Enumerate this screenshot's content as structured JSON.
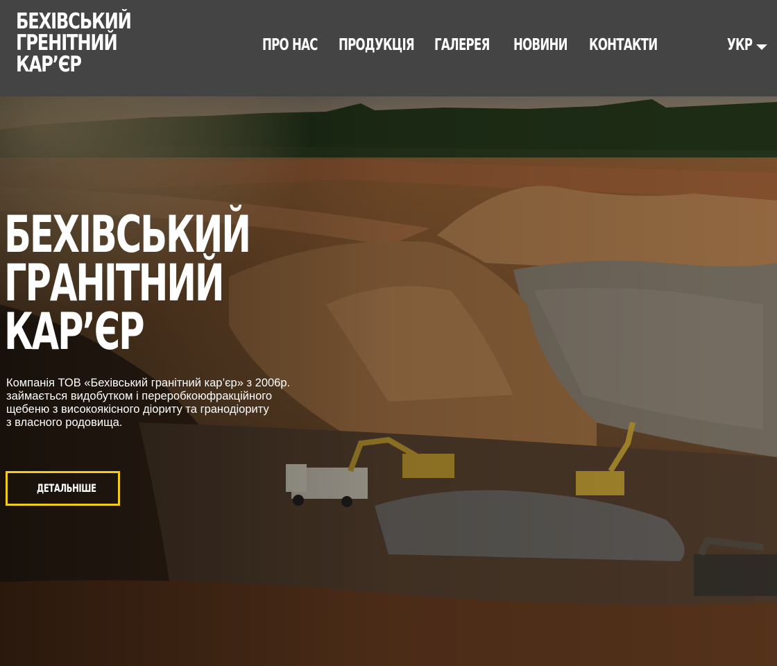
{
  "header": {
    "logo_lines": [
      "БЕХІВСЬКИЙ",
      "ГРЕНІТНИЙ",
      "КАР’ЄР"
    ],
    "nav": [
      {
        "label": "ПРО НАС"
      },
      {
        "label": "ПРОДУКЦІЯ"
      },
      {
        "label": "ГАЛЕРЕЯ"
      },
      {
        "label": "НОВИНИ"
      },
      {
        "label": "КОНТАКТИ"
      }
    ],
    "language": {
      "label": "УКР",
      "icon": "chevron-down-icon"
    }
  },
  "hero": {
    "background": "quarry-photo",
    "title_lines": [
      "БЕХІВСЬКИЙ",
      "ГРАНІТНИЙ",
      "КАР’ЄР"
    ],
    "description_lines": [
      "Компанія ТОВ «Бехівський гранітний кар’єр» з 2006р.",
      "займається видобутком і переробкоюфракційного",
      "щебеню з високоякісного діориту та гранодіориту",
      "з власного родовища."
    ],
    "button_label": "ДЕТАЛЬНІШЕ"
  },
  "colors": {
    "header_bg": "#444444",
    "accent": "#f1cc1a",
    "text": "#ffffff"
  }
}
